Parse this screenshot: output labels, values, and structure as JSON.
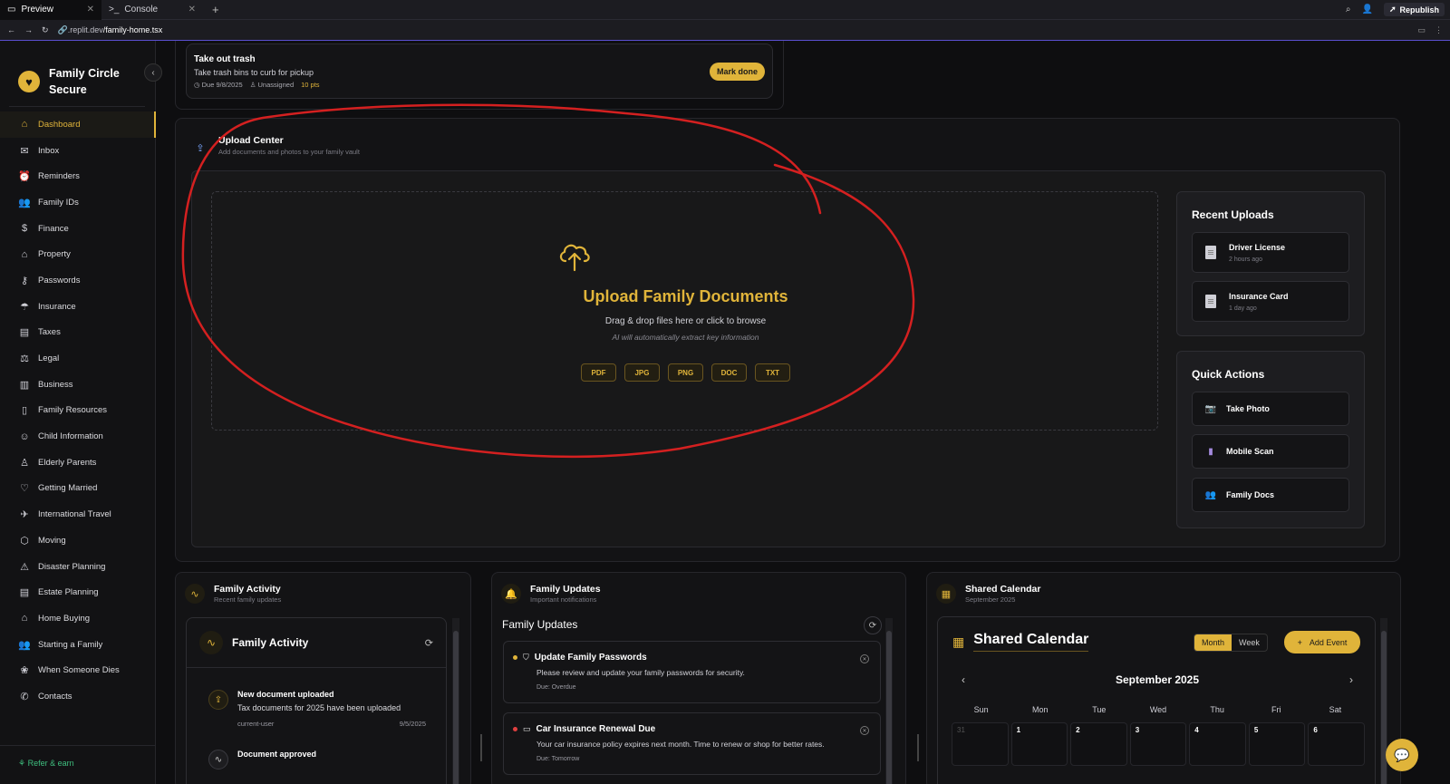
{
  "browser": {
    "tabs": [
      {
        "label": "Preview",
        "icon": "monitor-icon",
        "active": true
      },
      {
        "label": "Console",
        "icon": "terminal-icon",
        "active": false
      }
    ],
    "republish_label": "Republish",
    "url_prefix": ".replit.dev",
    "url_path": "/family-home.tsx"
  },
  "sidebar": {
    "brand_name": "Family Circle Secure",
    "items": [
      {
        "label": "Dashboard",
        "icon": "home-icon",
        "active": true
      },
      {
        "label": "Inbox",
        "icon": "inbox-icon"
      },
      {
        "label": "Reminders",
        "icon": "alarm-icon"
      },
      {
        "label": "Family IDs",
        "icon": "users-icon"
      },
      {
        "label": "Finance",
        "icon": "dollar-icon"
      },
      {
        "label": "Property",
        "icon": "house-icon"
      },
      {
        "label": "Passwords",
        "icon": "key-icon"
      },
      {
        "label": "Insurance",
        "icon": "umbrella-icon"
      },
      {
        "label": "Taxes",
        "icon": "receipt-icon"
      },
      {
        "label": "Legal",
        "icon": "scale-icon"
      },
      {
        "label": "Business",
        "icon": "building-icon"
      },
      {
        "label": "Family Resources",
        "icon": "book-icon"
      },
      {
        "label": "Child Information",
        "icon": "baby-icon"
      },
      {
        "label": "Elderly Parents",
        "icon": "user-heart-icon"
      },
      {
        "label": "Getting Married",
        "icon": "heart-icon"
      },
      {
        "label": "International Travel",
        "icon": "plane-icon"
      },
      {
        "label": "Moving",
        "icon": "box-icon"
      },
      {
        "label": "Disaster Planning",
        "icon": "warning-icon"
      },
      {
        "label": "Estate Planning",
        "icon": "document-icon"
      },
      {
        "label": "Home Buying",
        "icon": "home-icon"
      },
      {
        "label": "Starting a Family",
        "icon": "family-icon"
      },
      {
        "label": "When Someone Dies",
        "icon": "flower-icon"
      },
      {
        "label": "Contacts",
        "icon": "phone-icon"
      }
    ],
    "refer_label": "Refer & earn"
  },
  "chore": {
    "title": "Take out trash",
    "description": "Take trash bins to curb for pickup",
    "due": "Due 9/8/2025",
    "assignee": "Unassigned",
    "points": "10 pts",
    "action_label": "Mark done"
  },
  "upload_center": {
    "title": "Upload Center",
    "subtitle": "Add documents and photos to your family vault",
    "dropzone": {
      "title": "Upload Family Documents",
      "description": "Drag & drop files here or click to browse",
      "ai_note": "AI will automatically extract key information",
      "file_types": [
        "PDF",
        "JPG",
        "PNG",
        "DOC",
        "TXT"
      ]
    },
    "recent_uploads": {
      "title": "Recent Uploads",
      "items": [
        {
          "name": "Driver License",
          "time": "2 hours ago"
        },
        {
          "name": "Insurance Card",
          "time": "1 day ago"
        }
      ]
    },
    "quick_actions": {
      "title": "Quick Actions",
      "items": [
        {
          "label": "Take Photo",
          "icon": "camera-icon"
        },
        {
          "label": "Mobile Scan",
          "icon": "phone-scan-icon"
        },
        {
          "label": "Family Docs",
          "icon": "people-icon"
        }
      ]
    }
  },
  "family_activity": {
    "title": "Family Activity",
    "subtitle": "Recent family updates",
    "inner_title": "Family Activity",
    "items": [
      {
        "title": "New document uploaded",
        "description": "Tax documents for 2025 have been uploaded",
        "user": "current-user",
        "date": "9/5/2025"
      },
      {
        "title": "Document approved"
      }
    ]
  },
  "family_updates": {
    "title": "Family Updates",
    "subtitle": "Important notifications",
    "inner_title": "Family Updates",
    "items": [
      {
        "title": "Update Family Passwords",
        "description": "Please review and update your family passwords for security.",
        "due": "Due: Overdue",
        "color": "#e0b43a"
      },
      {
        "title": "Car Insurance Renewal Due",
        "description": "Your car insurance policy expires next month. Time to renew or shop for better rates.",
        "due": "Due: Tomorrow",
        "color": "#e04040"
      }
    ]
  },
  "shared_calendar": {
    "title": "Shared Calendar",
    "subtitle": "September 2025",
    "inner_title": "Shared Calendar",
    "view_month": "Month",
    "view_week": "Week",
    "add_event_label": "Add Event",
    "month_label": "September 2025",
    "weekdays": [
      "Sun",
      "Mon",
      "Tue",
      "Wed",
      "Thu",
      "Fri",
      "Sat"
    ],
    "days": [
      "31",
      "1",
      "2",
      "3",
      "4",
      "5",
      "6"
    ]
  }
}
